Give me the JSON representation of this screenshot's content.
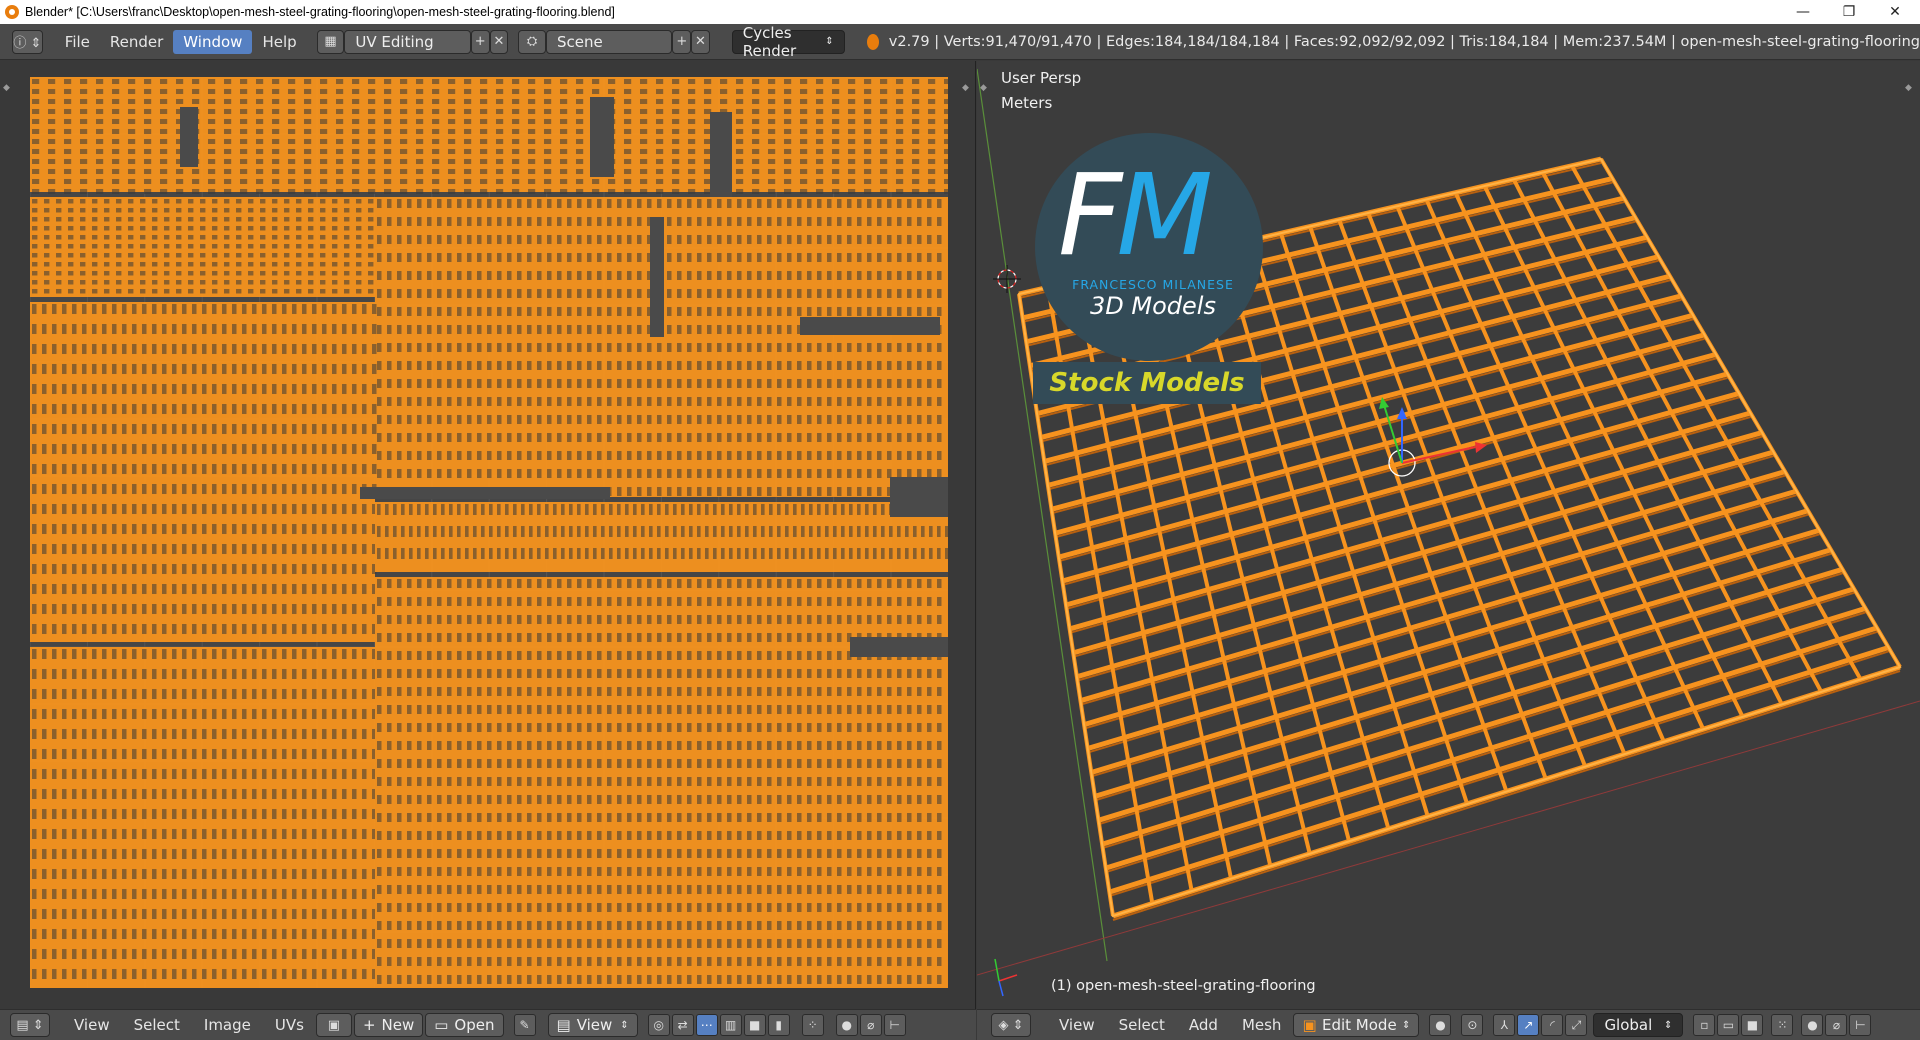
{
  "window": {
    "title": "Blender* [C:\\Users\\franc\\Desktop\\open-mesh-steel-grating-flooring\\open-mesh-steel-grating-flooring.blend]",
    "controls": [
      "—",
      "❐",
      "✕"
    ]
  },
  "info_header": {
    "menus": [
      "File",
      "Render",
      "Window",
      "Help"
    ],
    "active_menu": "Window",
    "screen_layout": "UV Editing",
    "scene": "Scene",
    "render_engine": "Cycles Render",
    "stats": "v2.79 | Verts:91,470/91,470 | Edges:184,184/184,184 | Faces:92,092/92,092 | Tris:184,184 | Mem:237.54M | open-mesh-steel-grating-flooring"
  },
  "uv_editor": {
    "menus": [
      "View",
      "Select",
      "Image",
      "UVs"
    ],
    "new_label": "New",
    "open_label": "Open",
    "view_label": "View"
  },
  "view3d": {
    "view_name": "User Persp",
    "units": "Meters",
    "object_label": "(1) open-mesh-steel-grating-flooring",
    "menus": [
      "View",
      "Select",
      "Add",
      "Mesh"
    ],
    "mode": "Edit Mode",
    "orientation": "Global"
  },
  "watermark": {
    "letter_f": "F",
    "letter_m": "M",
    "subtitle": "FRANCESCO MILANESE",
    "tagline": "3D Models",
    "banner": "Stock Models"
  },
  "colors": {
    "mesh_orange": "#f7931e",
    "header_bg": "#4a4a4a",
    "active_blue": "#5680c2",
    "editor_bg": "#393939"
  }
}
